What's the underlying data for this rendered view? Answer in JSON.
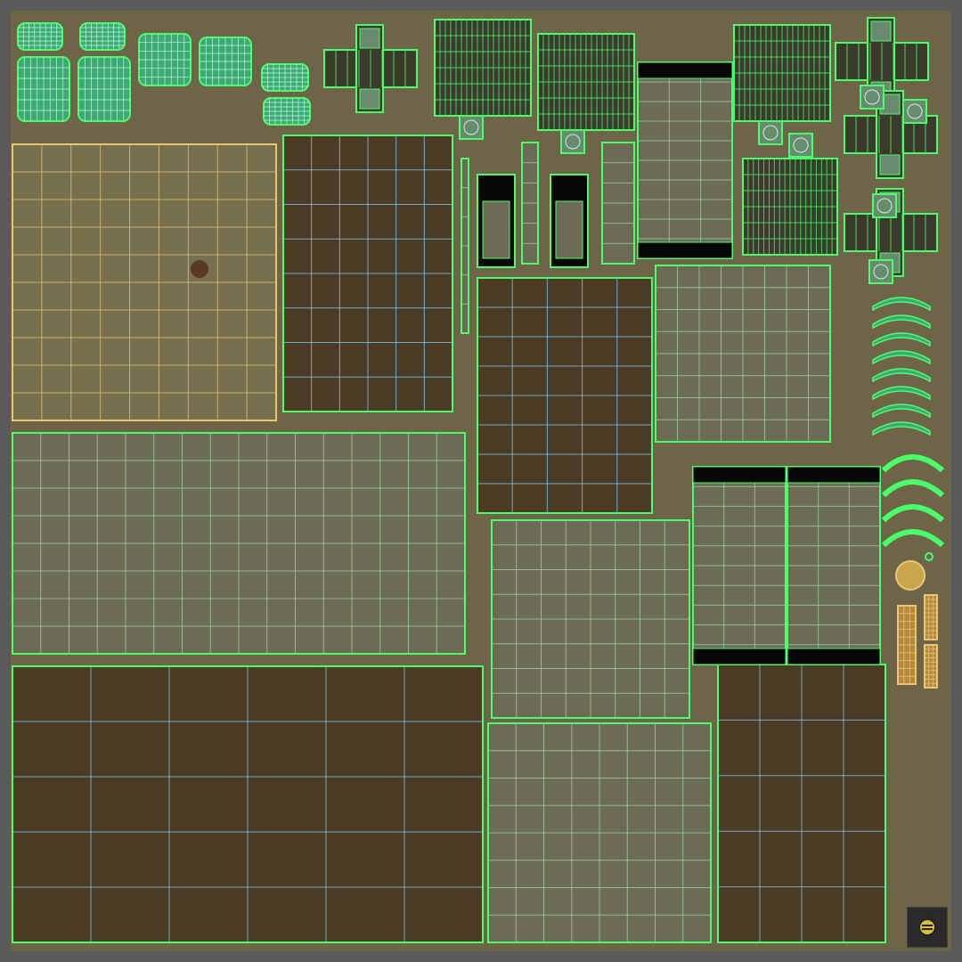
{
  "editor": {
    "title": "",
    "mode": "uv-layout",
    "grid_color": "#49ff6a",
    "wood_grid_color": "#7fd0ff",
    "seat_grid_color": "#e8c770",
    "texture_base": "#6e6548",
    "wood_dark": "#4b3b24",
    "panel_light": "#6d6a55"
  },
  "icons": {
    "corner": "uv-island-gizmo-icon"
  }
}
